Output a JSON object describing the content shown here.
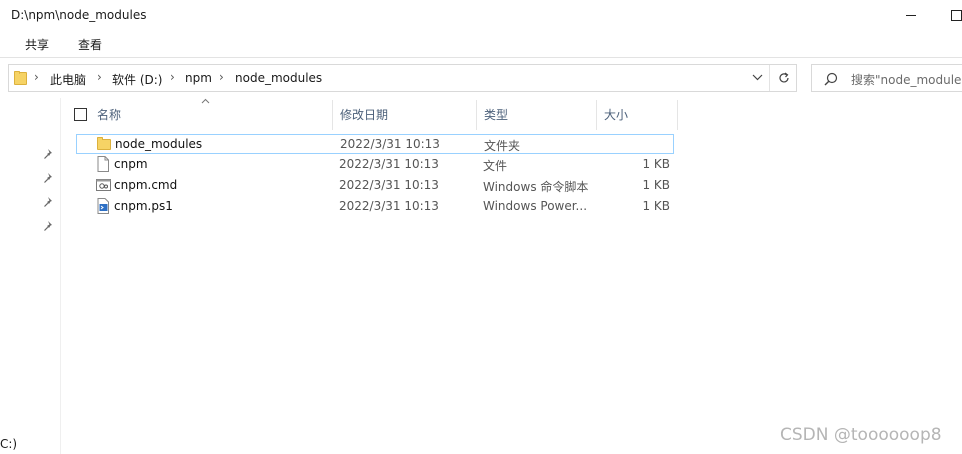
{
  "window": {
    "title": "D:\\npm\\node_modules"
  },
  "ribbon": {
    "tabs": [
      "共享",
      "查看"
    ]
  },
  "address": {
    "separators": [
      "›",
      "›",
      "›",
      "›"
    ],
    "segments": [
      "此电脑",
      "软件 (D:)",
      "npm",
      "node_modules"
    ]
  },
  "search": {
    "placeholder": "搜索\"node_modules\""
  },
  "nav": {
    "drive_label": "C:)"
  },
  "columns": {
    "name": "名称",
    "date": "修改日期",
    "type": "类型",
    "size": "大小"
  },
  "files": [
    {
      "name": "node_modules",
      "date": "2022/3/31 10:13",
      "type": "文件夹",
      "size": "",
      "icon": "folder-icon",
      "selected": true
    },
    {
      "name": "cnpm",
      "date": "2022/3/31 10:13",
      "type": "文件",
      "size": "1 KB",
      "icon": "file-icon",
      "selected": false
    },
    {
      "name": "cnpm.cmd",
      "date": "2022/3/31 10:13",
      "type": "Windows 命令脚本",
      "size": "1 KB",
      "icon": "cmd-script-icon",
      "selected": false
    },
    {
      "name": "cnpm.ps1",
      "date": "2022/3/31 10:13",
      "type": "Windows Power...",
      "size": "1 KB",
      "icon": "powershell-script-icon",
      "selected": false
    }
  ],
  "watermark": "CSDN @toooooop8",
  "colors": {
    "selection_border": "#99d1ff",
    "folder": "#f6d365",
    "header_text": "#4c607a"
  }
}
